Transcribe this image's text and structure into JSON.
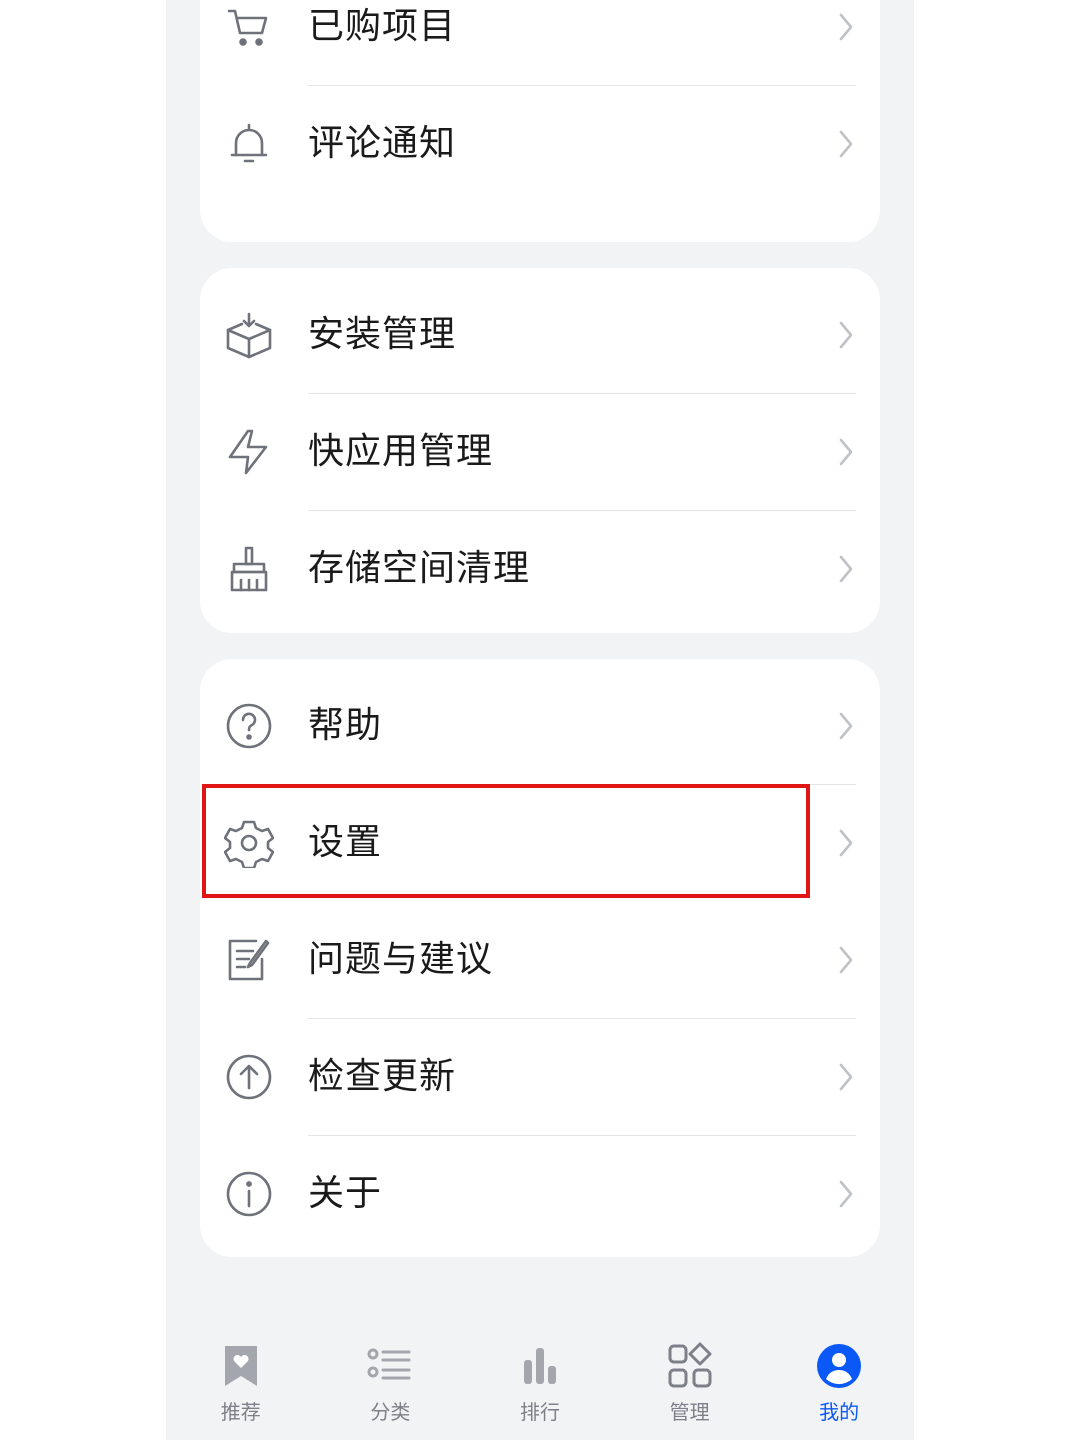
{
  "menu": {
    "group1": [
      {
        "label": "已购项目",
        "icon": "cart-icon"
      },
      {
        "label": "评论通知",
        "icon": "bell-icon"
      }
    ],
    "group2": [
      {
        "label": "安装管理",
        "icon": "box-install-icon"
      },
      {
        "label": "快应用管理",
        "icon": "lightning-icon"
      },
      {
        "label": "存储空间清理",
        "icon": "broom-icon"
      }
    ],
    "group3": [
      {
        "label": "帮助",
        "icon": "help-circle-icon"
      },
      {
        "label": "设置",
        "icon": "gear-icon",
        "highlighted": true
      },
      {
        "label": "问题与建议",
        "icon": "edit-note-icon"
      },
      {
        "label": "检查更新",
        "icon": "arrow-up-circle-icon"
      },
      {
        "label": "关于",
        "icon": "info-circle-icon"
      }
    ]
  },
  "tabbar": {
    "items": [
      {
        "label": "推荐",
        "icon": "bookmark-heart-icon"
      },
      {
        "label": "分类",
        "icon": "list-icon"
      },
      {
        "label": "排行",
        "icon": "bar-chart-icon"
      },
      {
        "label": "管理",
        "icon": "apps-grid-icon"
      },
      {
        "label": "我的",
        "icon": "user-icon",
        "active": true
      }
    ]
  },
  "colors": {
    "accent": "#0a59f7",
    "highlight_box": "#e01515",
    "background": "#f1f3f5",
    "icon_gray": "#7d8088"
  }
}
